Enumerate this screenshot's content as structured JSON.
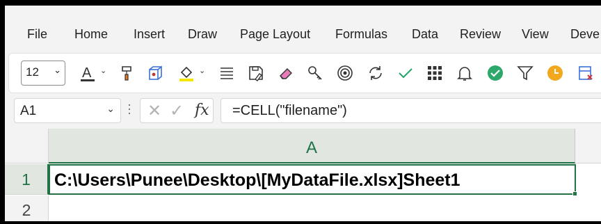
{
  "menu": {
    "items": [
      "File",
      "Home",
      "Insert",
      "Draw",
      "Page Layout",
      "Formulas",
      "Data",
      "Review",
      "View",
      "Deve"
    ]
  },
  "ribbon": {
    "font_size": "12",
    "font_color_letter": "A",
    "icons": [
      "font-color-icon",
      "format-painter-icon",
      "3d-box-icon",
      "fill-color-icon",
      "align-icon",
      "save-edit-icon",
      "eraser-icon",
      "key-icon",
      "target-icon",
      "refresh-icon",
      "checkmark-icon",
      "grid-icon",
      "bell-icon",
      "check-circle-icon",
      "filter-icon",
      "clock-icon",
      "cancel-table-icon"
    ],
    "accent_color": "#217346"
  },
  "formula_bar": {
    "name_box": "A1",
    "fx_label": "fx",
    "formula": "=CELL(\"filename\")"
  },
  "grid": {
    "column_header": "A",
    "rows": [
      "1",
      "2"
    ],
    "cell_a1": "C:\\Users\\Punee\\Desktop\\[MyDataFile.xlsx]Sheet1"
  }
}
